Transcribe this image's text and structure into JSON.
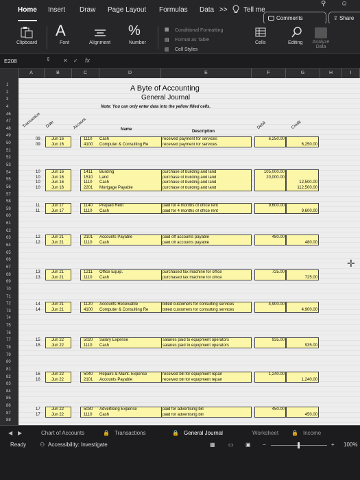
{
  "ribbon": {
    "tabs": [
      "Home",
      "Insert",
      "Draw",
      "Page Layout",
      "Formulas",
      "Data"
    ],
    "more": ">>",
    "tell_me": "Tell me",
    "comments": "Comments",
    "share": "Share",
    "groups": {
      "clipboard": "Clipboard",
      "font": "Font",
      "alignment": "Alignment",
      "number": "Number",
      "conditional_formatting": "Conditional Formatting",
      "format_as_table": "Format as Table",
      "cell_styles": "Cell Styles",
      "cells": "Cells",
      "editing": "Editing",
      "analyze_data": "Analyze Data",
      "number_symbol": "%",
      "font_symbol": "A"
    }
  },
  "formula_bar": {
    "name_box": "E208",
    "fx": "fx"
  },
  "columns": [
    "A",
    "B",
    "C",
    "D",
    "E",
    "F",
    "G",
    "H",
    "I"
  ],
  "sheet": {
    "title": "A Byte of Accounting",
    "subtitle": "General Journal",
    "note": "Note: You can only enter data into the yellow filled cells.",
    "header": {
      "transaction": "Transaction",
      "date": "Date",
      "account": "Account",
      "name": "Name",
      "description": "Description",
      "debit": "Debit",
      "credit": "Credit"
    },
    "row_numbers": [
      "1",
      "2",
      "3",
      "4",
      "46",
      "47",
      "48",
      "49",
      "50",
      "51",
      "52",
      "53",
      "54",
      "55",
      "56",
      "57",
      "58",
      "59",
      "60",
      "61",
      "62",
      "63",
      "64",
      "65",
      "66",
      "67",
      "68",
      "69",
      "70",
      "71",
      "72",
      "73",
      "74",
      "75",
      "76",
      "77",
      "78",
      "79",
      "80",
      "81",
      "82",
      "83",
      "84",
      "85",
      "86",
      "87",
      "88"
    ],
    "groups": [
      {
        "rows": [
          {
            "t": "09",
            "d": "Jun 16",
            "acct": "1110",
            "name": "Cash",
            "desc": "received payment for services",
            "debit": "6,250.00",
            "credit": ""
          },
          {
            "t": "09",
            "d": "Jun 16",
            "acct": "4100",
            "name": "Computer & Consulting Re",
            "desc": "received payment for services",
            "debit": "",
            "credit": "6,250.00"
          }
        ]
      },
      {
        "rows": [
          {
            "t": "10",
            "d": "Jun 16",
            "acct": "1411",
            "name": "Building",
            "desc": "purchase of building and land",
            "debit": "105,000.00",
            "credit": ""
          },
          {
            "t": "10",
            "d": "Jun 16",
            "acct": "1510",
            "name": "Land",
            "desc": "purchase of building and land",
            "debit": "20,000.00",
            "credit": ""
          },
          {
            "t": "10",
            "d": "Jun 16",
            "acct": "1110",
            "name": "Cash",
            "desc": "purchase of building and land",
            "debit": "",
            "credit": "12,500.00"
          },
          {
            "t": "10",
            "d": "Jun 16",
            "acct": "2201",
            "name": "Mortgage Payable",
            "desc": "purchase of building and land",
            "debit": "",
            "credit": "112,500.00"
          }
        ]
      },
      {
        "rows": [
          {
            "t": "11",
            "d": "Jun 17",
            "acct": "1140",
            "name": "Prepaid Rent",
            "desc": "paid for 4 months of office rent",
            "debit": "9,600.00",
            "credit": ""
          },
          {
            "t": "11",
            "d": "Jun 17",
            "acct": "1110",
            "name": "Cash",
            "desc": "paid for 4 months of office rent",
            "debit": "",
            "credit": "9,600.00"
          }
        ]
      },
      {
        "rows": [
          {
            "t": "12",
            "d": "Jun 21",
            "acct": "2101",
            "name": "Accounts Payable",
            "desc": "paid off accounts payable",
            "debit": "480.00",
            "credit": ""
          },
          {
            "t": "12",
            "d": "Jun 21",
            "acct": "1110",
            "name": "Cash",
            "desc": "paid off accounts payable",
            "debit": "",
            "credit": "480.00"
          }
        ]
      },
      {
        "rows": [
          {
            "t": "13",
            "d": "Jun 21",
            "acct": "1211",
            "name": "Office Equip.",
            "desc": "purchased fax machine for office",
            "debit": "725.00",
            "credit": ""
          },
          {
            "t": "13",
            "d": "Jun 21",
            "acct": "1110",
            "name": "Cash",
            "desc": "purchased fax machine for office",
            "debit": "",
            "credit": "725.00"
          }
        ]
      },
      {
        "rows": [
          {
            "t": "14",
            "d": "Jun 21",
            "acct": "1120",
            "name": "Accounts Receivable",
            "desc": "billed customers for consulting services",
            "debit": "4,900.00",
            "credit": ""
          },
          {
            "t": "14",
            "d": "Jun 21",
            "acct": "4100",
            "name": "Computer & Consulting Re",
            "desc": "billed customers for consulting services",
            "debit": "",
            "credit": "4,900.00"
          }
        ]
      },
      {
        "rows": [
          {
            "t": "15",
            "d": "Jun 22",
            "acct": "5020",
            "name": "Salary Expense",
            "desc": "salaries paid to equipment operators",
            "debit": "935.00",
            "credit": ""
          },
          {
            "t": "15",
            "d": "Jun 22",
            "acct": "1110",
            "name": "Cash",
            "desc": "salaries paid to equipment operators",
            "debit": "",
            "credit": "935.00"
          }
        ]
      },
      {
        "rows": [
          {
            "t": "16",
            "d": "Jun 22",
            "acct": "5040",
            "name": "Repairs & Maint. Expense",
            "desc": "received bill for equipment repair",
            "debit": "1,240.00",
            "credit": ""
          },
          {
            "t": "16",
            "d": "Jun 22",
            "acct": "2101",
            "name": "Accounts Payable",
            "desc": "received bill for equipment repair",
            "debit": "",
            "credit": "1,240.00"
          }
        ]
      },
      {
        "rows": [
          {
            "t": "17",
            "d": "Jun 22",
            "acct": "5030",
            "name": "Advertising Expense",
            "desc": "paid for advertising bill",
            "debit": "450.00",
            "credit": ""
          },
          {
            "t": "17",
            "d": "Jun 22",
            "acct": "1110",
            "name": "Cash",
            "desc": "paid for advertising bill",
            "debit": "",
            "credit": "450.00"
          }
        ]
      }
    ]
  },
  "sheet_tabs": [
    "Chart of Accounts",
    "Transactions",
    "General Journal",
    "Worksheet",
    "Income"
  ],
  "status": {
    "ready": "Ready",
    "accessibility": "Accessibility: Investigate",
    "zoom": "100%"
  }
}
